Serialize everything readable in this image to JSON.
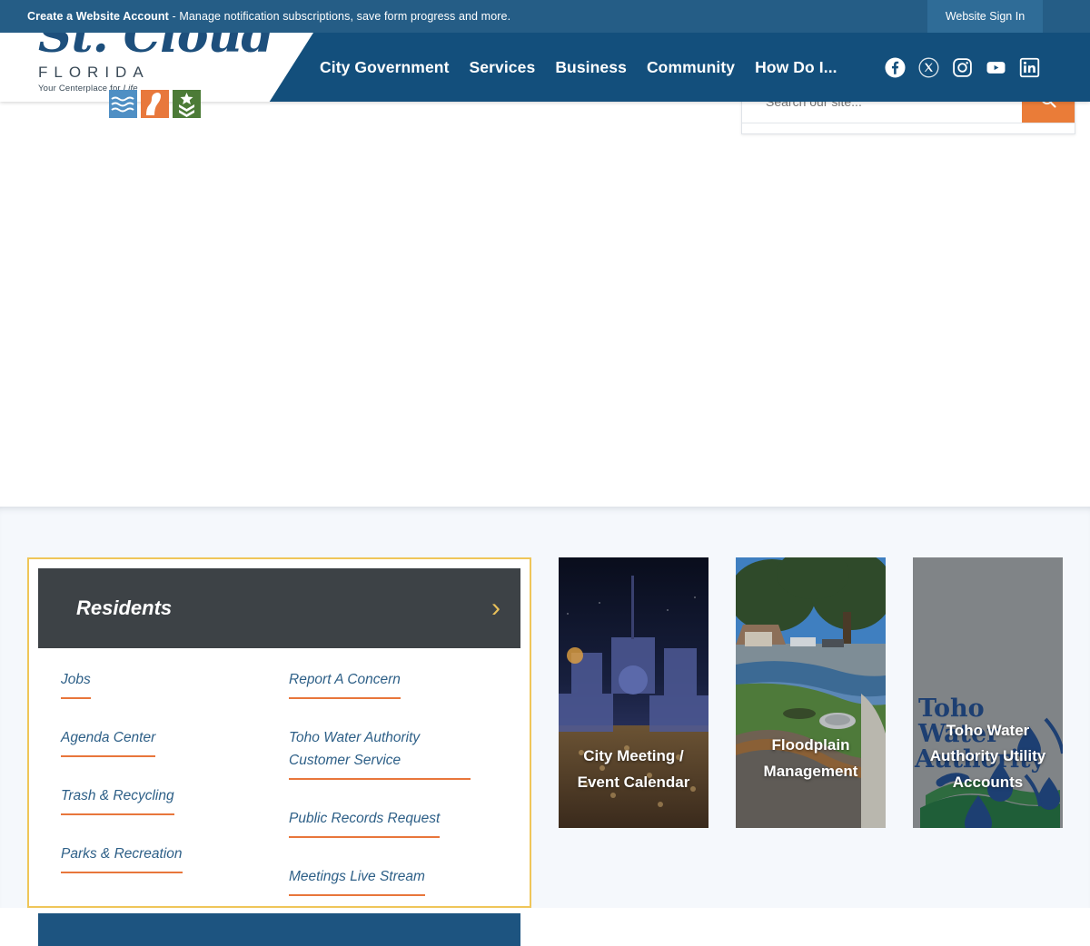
{
  "top_banner": {
    "link_bold": "Create a Website Account",
    "rest": " - Manage notification subscriptions, save form progress and more.",
    "signin_label": "Website Sign In"
  },
  "header": {
    "logo": {
      "script": "St. Cloud",
      "state": "FLORIDA",
      "tagline_pre": "Your Centerplace for ",
      "tagline_em": "Life",
      "icons": [
        "water-waves-icon",
        "heron-bird-icon",
        "military-chevron-icon"
      ]
    },
    "nav": [
      {
        "label": "City Government",
        "name": "nav-city-government"
      },
      {
        "label": "Services",
        "name": "nav-services"
      },
      {
        "label": "Business",
        "name": "nav-business"
      },
      {
        "label": "Community",
        "name": "nav-community"
      },
      {
        "label": "How Do I...",
        "name": "nav-how-do-i"
      }
    ],
    "social": [
      {
        "name": "facebook-icon",
        "label": "Facebook"
      },
      {
        "name": "x-twitter-icon",
        "label": "X"
      },
      {
        "name": "instagram-icon",
        "label": "Instagram"
      },
      {
        "name": "youtube-icon",
        "label": "YouTube"
      },
      {
        "name": "linkedin-icon",
        "label": "LinkedIn"
      }
    ]
  },
  "search": {
    "placeholder": "Search our site...",
    "value": "",
    "button_icon": "search-icon"
  },
  "residents_widget": {
    "title": "Residents",
    "chevron_icon": "chevron-right-icon",
    "columns": [
      {
        "links": [
          "Jobs",
          "Agenda Center",
          "Trash & Recycling",
          "Parks & Recreation"
        ]
      },
      {
        "links": [
          "Report A Concern",
          "Toho Water Authority Customer Service",
          "Public Records Request",
          "Meetings Live Stream"
        ]
      }
    ]
  },
  "feature_cards": [
    {
      "label": "City Meeting / Event Calendar",
      "image_alt": "night-aerial-festival-crowd",
      "name": "card-city-meeting-event-calendar"
    },
    {
      "label": "Floodplain Management",
      "image_alt": "flooded-residential-street",
      "name": "card-floodplain-management"
    },
    {
      "label": "Toho Water Authority Utility Accounts",
      "image_alt": "toho-water-authority-logo",
      "name": "card-toho-water-utility-accounts"
    }
  ],
  "colors": {
    "banner_blue": "#255d86",
    "header_blue": "#134f7c",
    "accent_orange": "#e8763b",
    "accent_yellow": "#efc659",
    "widget_header_gray": "#3d4246",
    "link_blue": "#2d5f87",
    "section_bg": "#f5f8fc",
    "bottom_bar_blue": "#1d5480"
  }
}
